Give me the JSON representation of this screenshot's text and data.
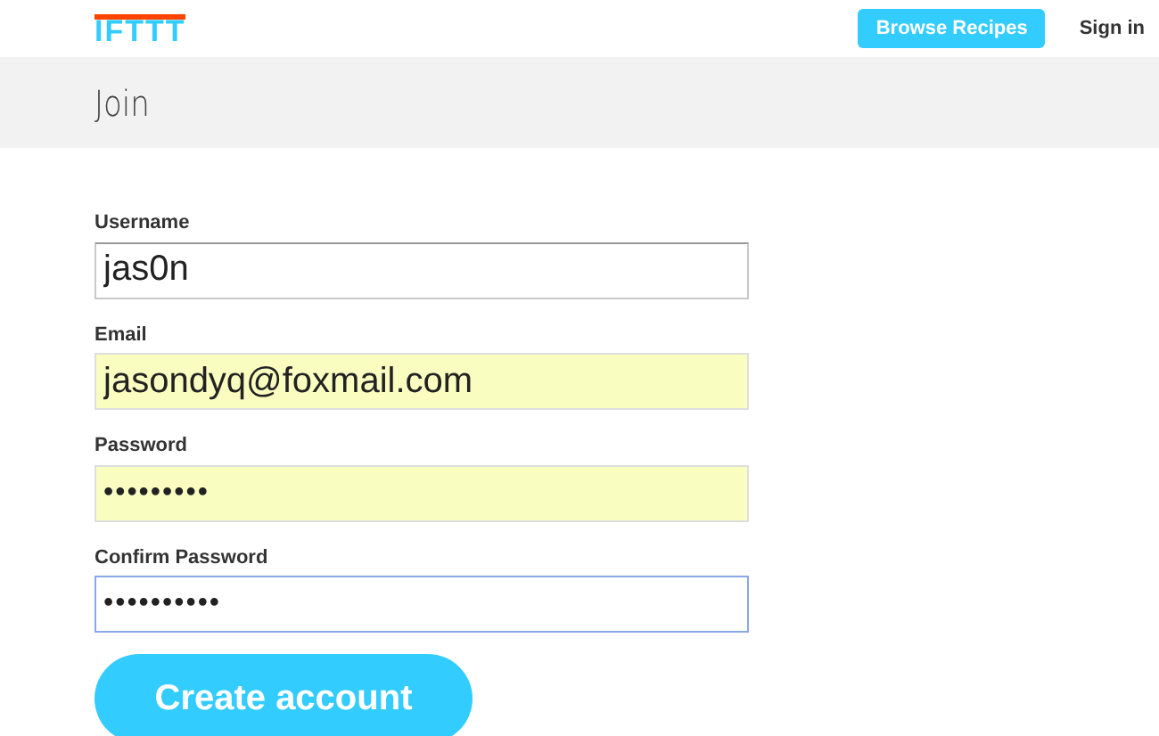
{
  "header": {
    "logo": "IFTTT",
    "browse_button": "Browse Recipes",
    "sign_in": "Sign in"
  },
  "page_title": "Join",
  "fields": [
    {
      "label": "Username",
      "value": "jas0n",
      "autofilled": false,
      "focused": false,
      "kind": "text"
    },
    {
      "label": "Email",
      "value": "jasondyq@foxmail.com",
      "autofilled": true,
      "focused": false,
      "kind": "text"
    },
    {
      "label": "Password",
      "value": "•••••••••",
      "autofilled": true,
      "focused": false,
      "kind": "masked"
    },
    {
      "label": "Confirm Password",
      "value": "••••••••••",
      "autofilled": false,
      "focused": true,
      "kind": "masked"
    }
  ],
  "submit_button": "Create account"
}
